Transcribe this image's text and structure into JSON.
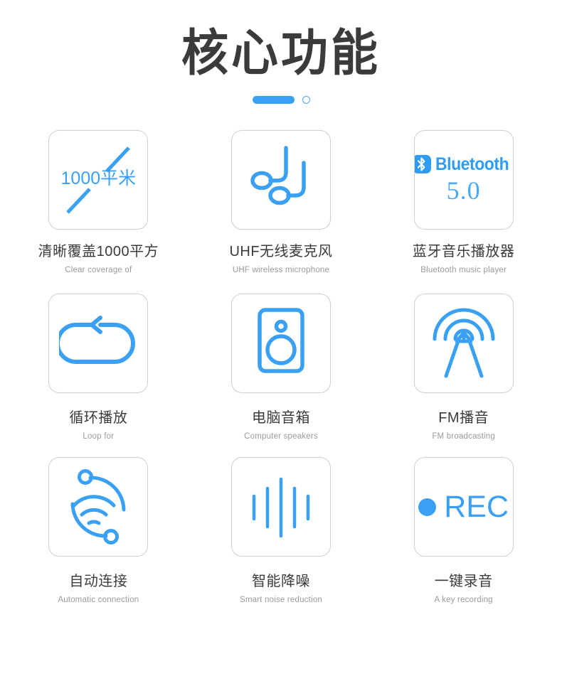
{
  "header": {
    "title": "核心功能",
    "pagination": {
      "active_indicator": "page-1-active",
      "inactive_indicator": "page-2",
      "accent_color": "#3aa0f3"
    }
  },
  "theme": {
    "accent": "#3aa0f3",
    "title_color": "#3b3b3b",
    "label_color": "#3b3b3b",
    "sublabel_color": "#9a9a9a",
    "card_border": "#cfcfcf",
    "background": "#ffffff"
  },
  "features": [
    {
      "icon": "coverage-area-icon",
      "icon_text": "1000平米",
      "label_cn": "清晰覆盖1000平方",
      "label_en": "Clear coverage of"
    },
    {
      "icon": "music-notes-icon",
      "label_cn": "UHF无线麦克风",
      "label_en": "UHF wireless microphone"
    },
    {
      "icon": "bluetooth-icon",
      "icon_text": "Bluetooth",
      "icon_version": "5.0",
      "label_cn": "蓝牙音乐播放器",
      "label_en": "Bluetooth music player"
    },
    {
      "icon": "loop-arrow-icon",
      "label_cn": "循环播放",
      "label_en": "Loop for"
    },
    {
      "icon": "speaker-box-icon",
      "label_cn": "电脑音箱",
      "label_en": "Computer speakers"
    },
    {
      "icon": "radio-tower-icon",
      "label_cn": "FM播音",
      "label_en": "FM broadcasting"
    },
    {
      "icon": "auto-connect-wifi-icon",
      "label_cn": "自动连接",
      "label_en": "Automatic connection"
    },
    {
      "icon": "waveform-icon",
      "label_cn": "智能降噪",
      "label_en": "Smart noise reduction"
    },
    {
      "icon": "record-icon",
      "icon_text": "REC",
      "label_cn": "一键录音",
      "label_en": "A key recording"
    }
  ]
}
